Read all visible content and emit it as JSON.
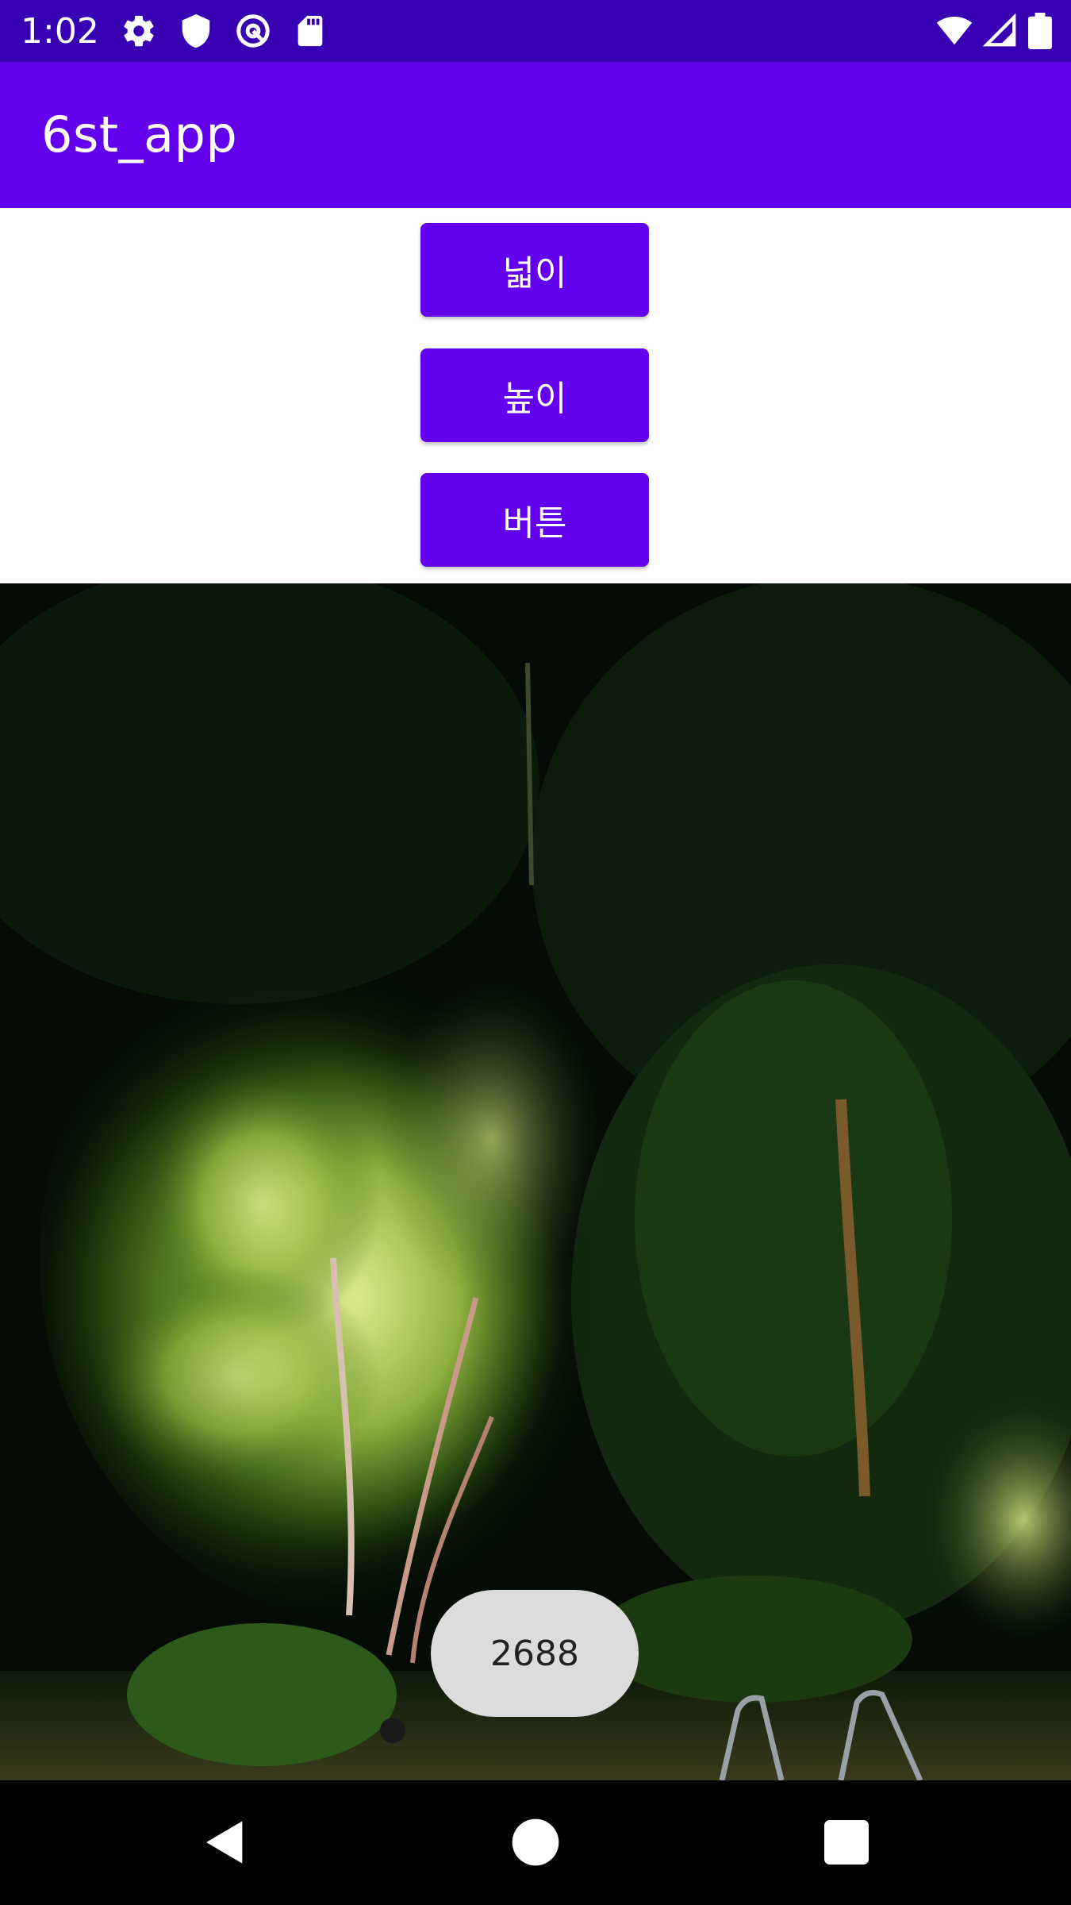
{
  "status_bar": {
    "time": "1:02",
    "left_icons": [
      "gear-icon",
      "shield-icon",
      "at-sign-icon",
      "sd-card-icon"
    ],
    "right_icons": [
      "wifi-icon",
      "cell-signal-icon",
      "battery-icon"
    ]
  },
  "app_bar": {
    "title": "6st_app"
  },
  "buttons": {
    "width_label": "넓이",
    "height_label": "높이",
    "button_label": "버튼"
  },
  "image": {
    "description_icon": "night-garden-photo"
  },
  "toast": {
    "text": "2688"
  },
  "nav_bar": {
    "icons": [
      "back-icon",
      "home-icon",
      "recents-icon"
    ]
  },
  "colors": {
    "primary": "#6200ee",
    "primary_dark": "#3700b3",
    "toast_bg": "#dcdcdc"
  }
}
